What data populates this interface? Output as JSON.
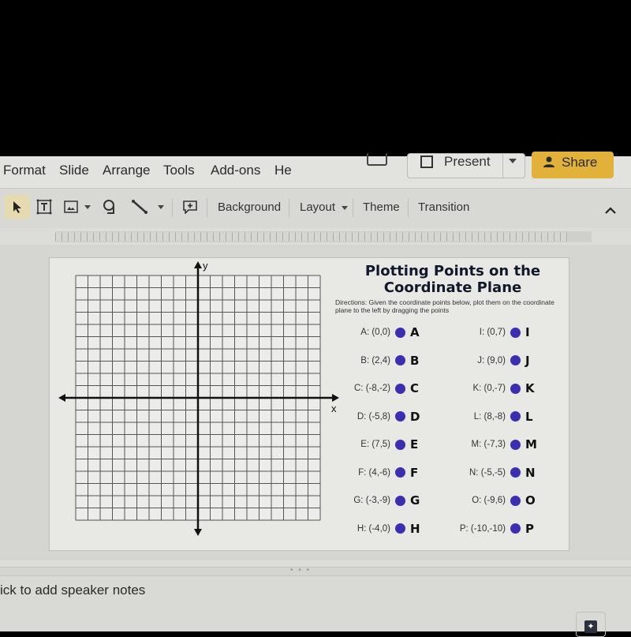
{
  "menu": {
    "items": [
      "Format",
      "Slide",
      "Arrange",
      "Tools",
      "Add-ons",
      "He"
    ],
    "present_label": "Present",
    "share_label": "Share",
    "share_color": "#e1b13a"
  },
  "toolbar": {
    "background_label": "Background",
    "layout_label": "Layout",
    "theme_label": "Theme",
    "transition_label": "Transition"
  },
  "slide": {
    "title_line1": "Plotting Points on the",
    "title_line2": "Coordinate Plane",
    "directions": "Directions:  Given the coordinate points below, plot them on the coordinate plane to the left by dragging the points",
    "axis_x_label": "x",
    "axis_y_label": "y",
    "grid": {
      "x_range": [
        -10,
        10
      ],
      "y_range": [
        -10,
        10
      ],
      "step": 1
    },
    "dot_color": "#3a2fb0",
    "points_left": [
      {
        "label": "A: (0,0)",
        "letter": "A"
      },
      {
        "label": "B: (2,4)",
        "letter": "B"
      },
      {
        "label": "C: (-8,-2)",
        "letter": "C"
      },
      {
        "label": "D: (-5,8)",
        "letter": "D"
      },
      {
        "label": "E: (7,5)",
        "letter": "E"
      },
      {
        "label": "F: (4,-6)",
        "letter": "F"
      },
      {
        "label": "G: (-3,-9)",
        "letter": "G"
      },
      {
        "label": "H: (-4,0)",
        "letter": "H"
      }
    ],
    "points_right": [
      {
        "label": "I: (0,7)",
        "letter": "I"
      },
      {
        "label": "J: (9,0)",
        "letter": "J"
      },
      {
        "label": "K: (0,-7)",
        "letter": "K"
      },
      {
        "label": "L: (8,-8)",
        "letter": "L"
      },
      {
        "label": "M: (-7,3)",
        "letter": "M"
      },
      {
        "label": "N: (-5,-5)",
        "letter": "N"
      },
      {
        "label": "O: (-9,6)",
        "letter": "O"
      },
      {
        "label": "P: (-10,-10)",
        "letter": "P"
      }
    ]
  },
  "notes": {
    "placeholder": "ick to add speaker notes",
    "splitter_dots": "• • •"
  }
}
